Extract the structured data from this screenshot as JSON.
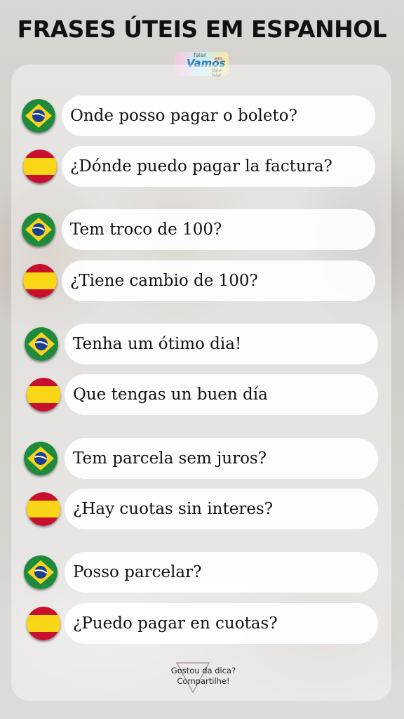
{
  "title": "FRASES ÚTEIS EM ESPANHOL",
  "logo": {
    "top": "falar",
    "main": "Vamos",
    "side": "em",
    "bottom": "bate-falar"
  },
  "phrases": [
    {
      "flag": "brazil-flag-icon",
      "text": "Onde posso pagar o boleto?"
    },
    {
      "flag": "spain-flag-icon",
      "text": "¿Dónde puedo pagar la factura?"
    },
    {
      "flag": "brazil-flag-icon",
      "text": "Tem troco de 100?"
    },
    {
      "flag": "spain-flag-icon",
      "text": "¿Tiene cambio de 100?"
    },
    {
      "flag": "brazil-flag-icon",
      "text": "Tenha um ótimo dia!"
    },
    {
      "flag": "spain-flag-icon",
      "text": "Que tengas un buen día"
    },
    {
      "flag": "brazil-flag-icon",
      "text": "Tem parcela sem juros?"
    },
    {
      "flag": "spain-flag-icon",
      "text": "¿Hay cuotas sin interes?"
    },
    {
      "flag": "brazil-flag-icon",
      "text": "Posso parcelar?"
    },
    {
      "flag": "spain-flag-icon",
      "text": "¿Puedo pagar en cuotas?"
    }
  ],
  "footer": {
    "line1": "Gostou da dica?",
    "line2": "Compartilhe!"
  },
  "colors": {
    "brazil_green": "#1f8a3b",
    "brazil_yellow": "#f6d41c",
    "brazil_blue": "#1c3f8f",
    "spain_red": "#c8102e",
    "spain_yellow": "#f9d616"
  }
}
